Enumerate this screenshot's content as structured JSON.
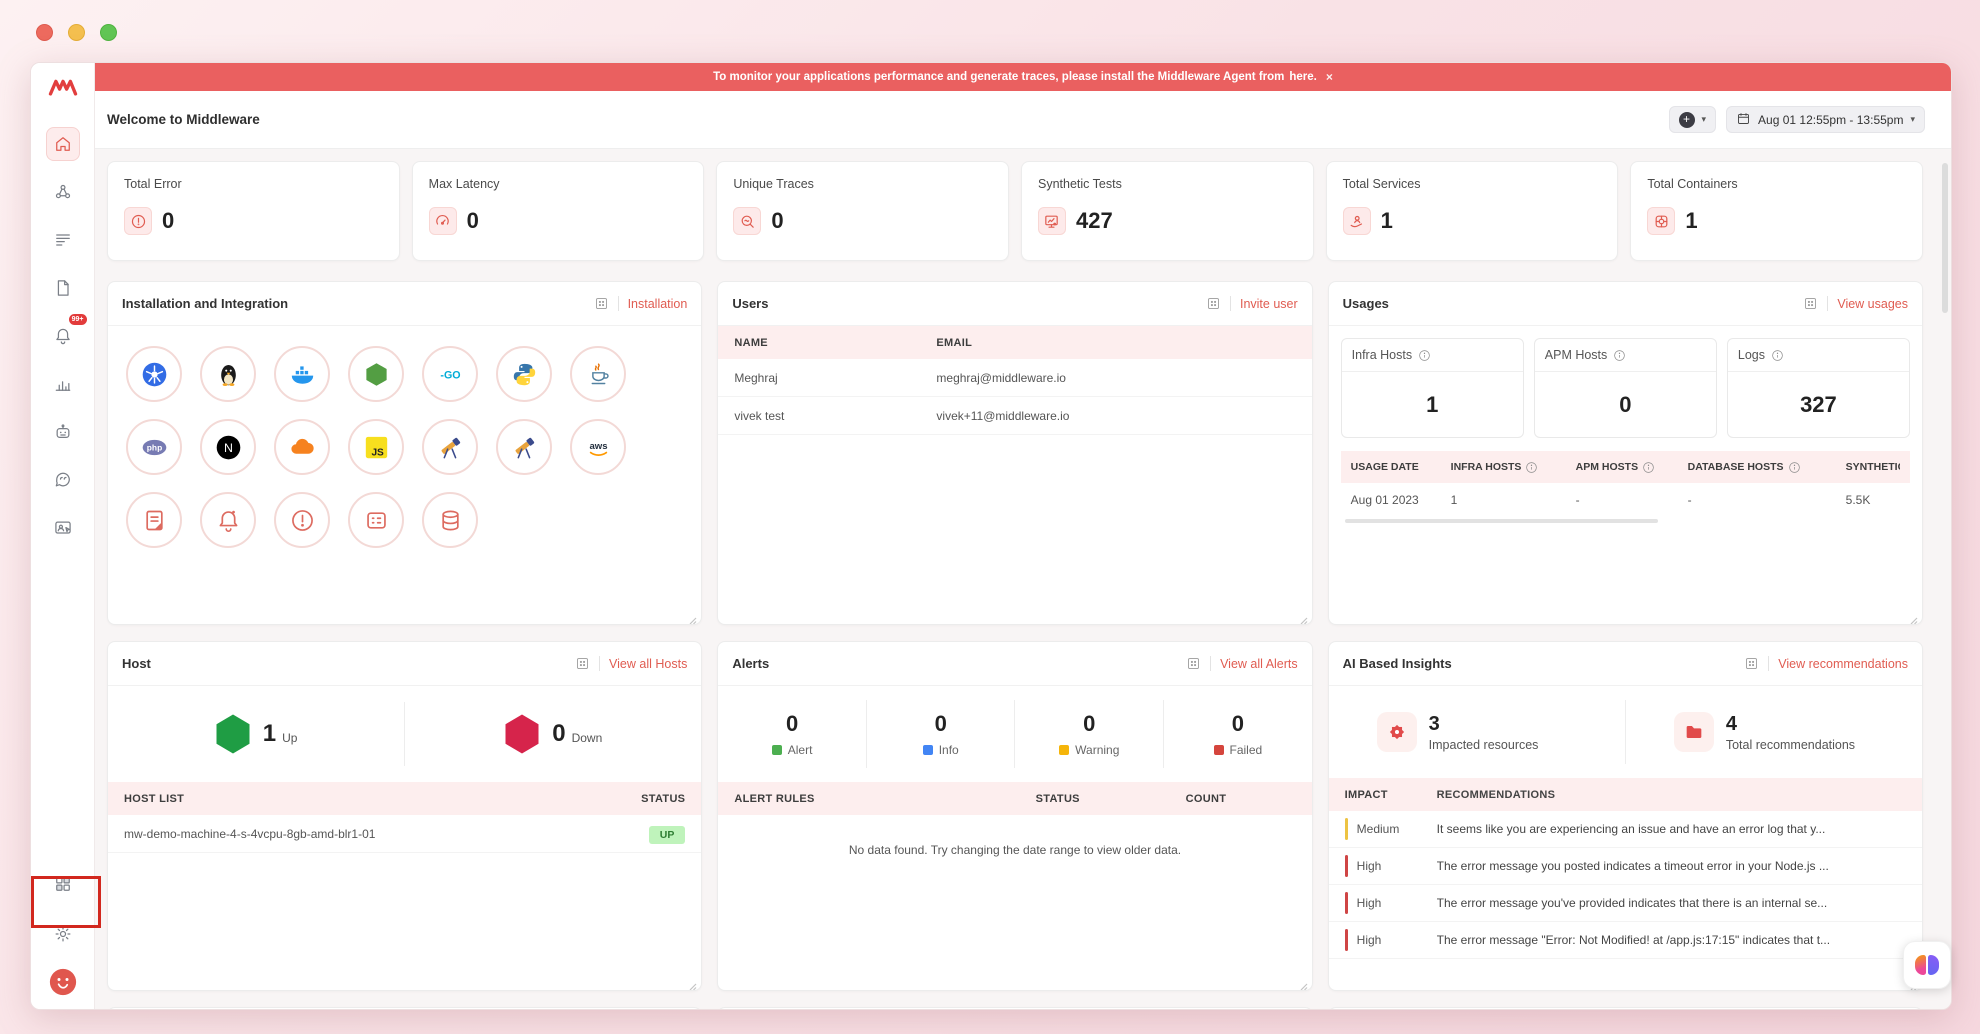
{
  "colors": {
    "accent": "#e05c51",
    "banner": "#ea6060",
    "table_header_bg": "#fdeeee"
  },
  "icons": {
    "plus": "+",
    "caret": "▾",
    "close": "×"
  },
  "banner": {
    "text": "To monitor your applications performance and generate traces, please install the Middleware Agent from",
    "link": "here."
  },
  "header": {
    "title": "Welcome to Middleware",
    "date_range": "Aug 01 12:55pm - 13:55pm"
  },
  "sidebar": {
    "items": [
      "home",
      "infrastructure",
      "logs",
      "traces",
      "alerts",
      "dashboards",
      "assistant",
      "feedback",
      "rum"
    ],
    "alert_badge": "99+",
    "bottom_items": [
      "apps",
      "settings",
      "profile"
    ]
  },
  "stats": [
    {
      "label": "Total Error",
      "value": "0",
      "icon": "stat-error"
    },
    {
      "label": "Max Latency",
      "value": "0",
      "icon": "stat-latency"
    },
    {
      "label": "Unique Traces",
      "value": "0",
      "icon": "stat-traces"
    },
    {
      "label": "Synthetic Tests",
      "value": "427",
      "icon": "stat-synthetic"
    },
    {
      "label": "Total Services",
      "value": "1",
      "icon": "stat-services"
    },
    {
      "label": "Total Containers",
      "value": "1",
      "icon": "stat-containers"
    }
  ],
  "installation": {
    "title": "Installation and Integration",
    "action": "Installation",
    "icons": [
      "kubernetes",
      "linux",
      "docker",
      "nodejs",
      "go",
      "python",
      "java",
      "php",
      "nextjs",
      "cloudflare",
      "javascript",
      "telescope",
      "telescope",
      "aws",
      "report",
      "bell",
      "alert",
      "table",
      "database"
    ]
  },
  "users": {
    "title": "Users",
    "action": "Invite user",
    "columns": [
      "NAME",
      "EMAIL"
    ],
    "rows": [
      {
        "name": "Meghraj",
        "email": "meghraj@middleware.io"
      },
      {
        "name": "vivek test",
        "email": "vivek+11@middleware.io"
      }
    ]
  },
  "usages": {
    "title": "Usages",
    "action": "View usages",
    "meters": [
      {
        "label": "Infra Hosts",
        "value": "1"
      },
      {
        "label": "APM Hosts",
        "value": "0"
      },
      {
        "label": "Logs",
        "value": "327"
      }
    ],
    "table": {
      "columns": [
        "USAGE DATE",
        "INFRA HOSTS",
        "APM HOSTS",
        "DATABASE HOSTS",
        "SYNTHETIC"
      ],
      "rows": [
        [
          "Aug 01 2023",
          "1",
          "-",
          "-",
          "5.5K"
        ]
      ]
    }
  },
  "host": {
    "title": "Host",
    "action": "View all Hosts",
    "up": {
      "value": "1",
      "label": "Up",
      "color": "#1f9d44"
    },
    "down": {
      "value": "0",
      "label": "Down",
      "color": "#d6244b"
    },
    "columns": [
      "HOST LIST",
      "STATUS"
    ],
    "rows": [
      {
        "host": "mw-demo-machine-4-s-4vcpu-8gb-amd-blr1-01",
        "status": "UP"
      }
    ]
  },
  "alerts": {
    "title": "Alerts",
    "action": "View all Alerts",
    "stats": [
      {
        "value": "0",
        "label": "Alert",
        "color": "#4caf50"
      },
      {
        "value": "0",
        "label": "Info",
        "color": "#4285f4"
      },
      {
        "value": "0",
        "label": "Warning",
        "color": "#f5b50a"
      },
      {
        "value": "0",
        "label": "Failed",
        "color": "#d5453d"
      }
    ],
    "columns": [
      "ALERT RULES",
      "STATUS",
      "COUNT"
    ],
    "empty": "No data found. Try changing the date range to view older data."
  },
  "insights": {
    "title": "AI Based Insights",
    "action": "View recommendations",
    "impacted": {
      "value": "3",
      "label": "Impacted resources"
    },
    "total": {
      "value": "4",
      "label": "Total recommendations"
    },
    "columns": [
      "IMPACT",
      "RECOMMENDATIONS"
    ],
    "rows": [
      {
        "impact": "Medium",
        "color": "#edc343",
        "text": "It seems like you are experiencing an issue and have an error log that y..."
      },
      {
        "impact": "High",
        "color": "#cf4545",
        "text": "The error message you posted indicates a timeout error in your Node.js ..."
      },
      {
        "impact": "High",
        "color": "#cf4545",
        "text": "The error message you've provided indicates that there is an internal se..."
      },
      {
        "impact": "High",
        "color": "#cf4545",
        "text": "The error message \"Error: Not Modified! at /app.js:17:15\" indicates that t..."
      }
    ]
  }
}
